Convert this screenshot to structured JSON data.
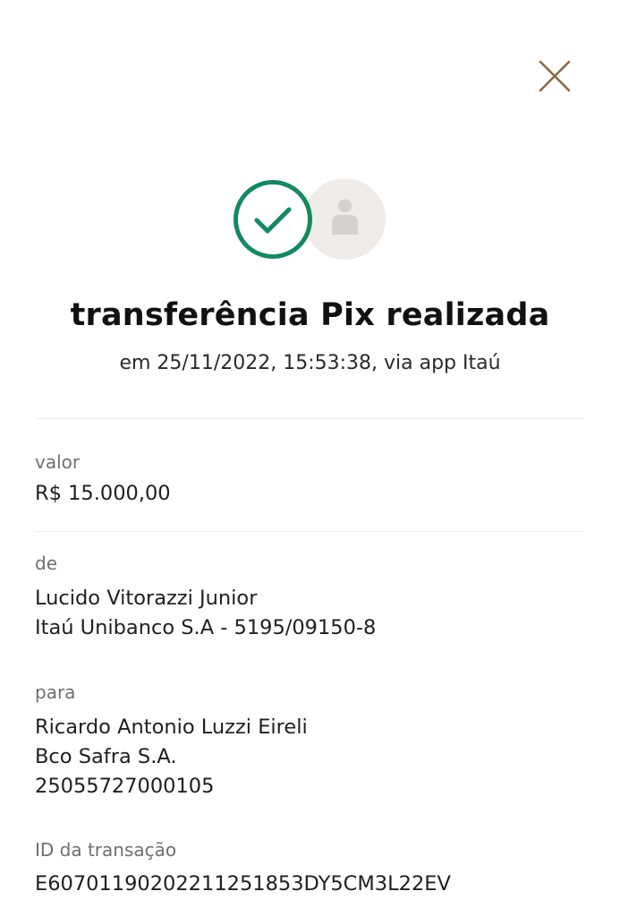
{
  "header": {
    "close_icon": "close-icon",
    "close_color": "#8a6a45"
  },
  "status": {
    "check_icon": "check-circle-icon",
    "check_color": "#138a5e",
    "avatar_icon": "person-icon",
    "avatar_bg": "#efebe8"
  },
  "title": "transferência Pix realizada",
  "subtitle": "em 25/11/2022, 15:53:38, via app Itaú",
  "sections": {
    "valor": {
      "label": "valor",
      "value": "R$ 15.000,00"
    },
    "de": {
      "label": "de",
      "name": "Lucido Vitorazzi Junior",
      "bank": "Itaú Unibanco S.A - 5195/09150-8"
    },
    "para": {
      "label": "para",
      "name": "Ricardo Antonio Luzzi Eireli",
      "bank": "Bco Safra S.A.",
      "document": "25055727000105"
    },
    "id": {
      "label": "ID da transação",
      "value": "E60701190202211251853DY5CM3L22EV"
    }
  }
}
